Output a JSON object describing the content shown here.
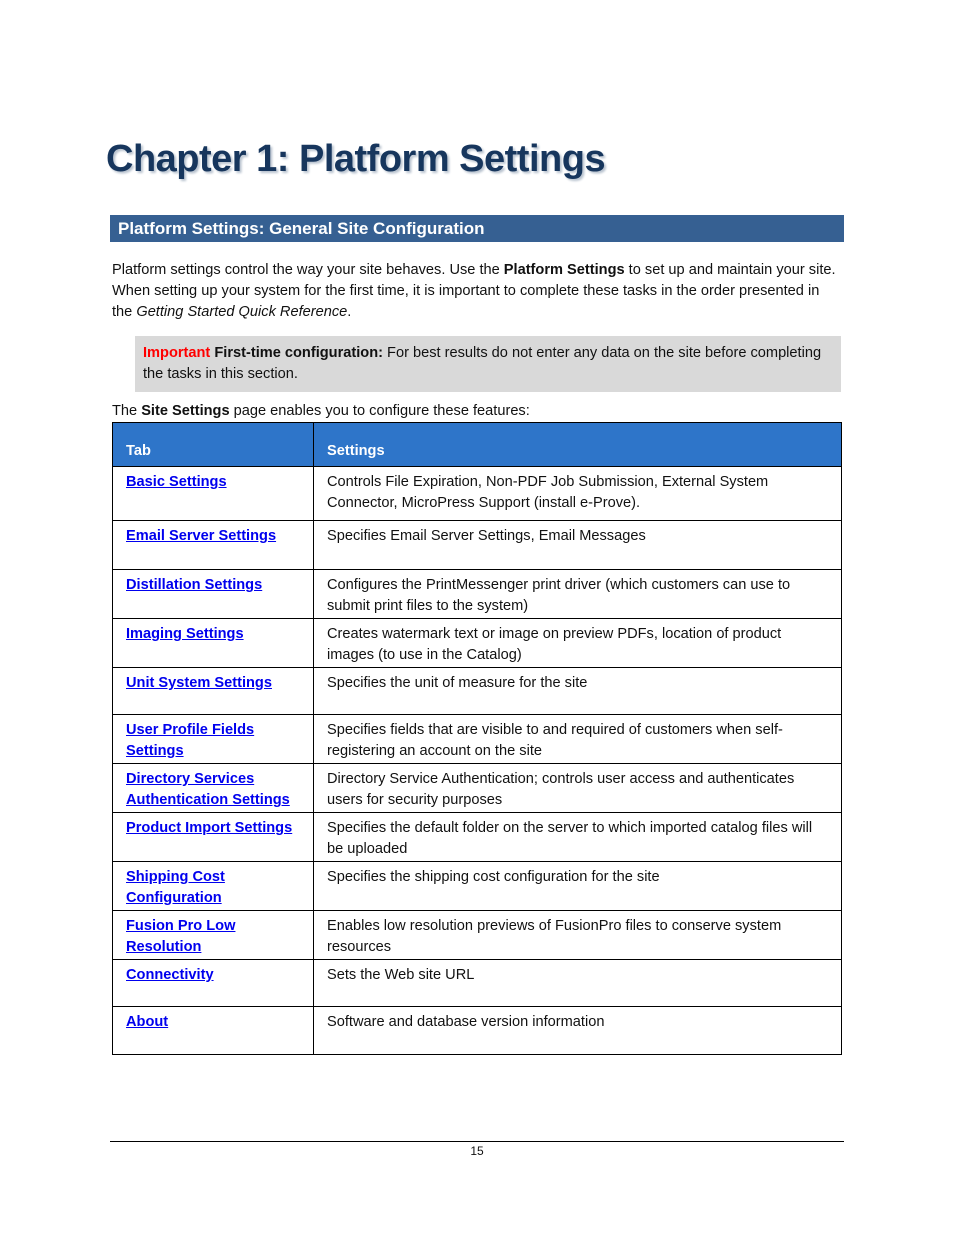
{
  "chapter_title": "Chapter 1: Platform Settings",
  "section_title": "Platform Settings: General Site Configuration",
  "intro": {
    "part1": "Platform settings control the way your site behaves. Use the ",
    "bold": "Platform Settings",
    "part2": " to set up and maintain your site. When setting up your system for the first time, it is important to complete these tasks in the order presented in the ",
    "italic": "Getting Started Quick Reference",
    "part3": "."
  },
  "note": {
    "important_label": "Important",
    "bold_label": "First-time configuration:",
    "text": " For best results do not enter any data on the site before completing the tasks in this section."
  },
  "lead": {
    "part1": "The ",
    "bold": "Site Settings",
    "part2": " page enables you to configure these features:"
  },
  "table": {
    "headers": [
      "Tab",
      "Settings"
    ],
    "rows": [
      {
        "tab": "Basic Settings",
        "settings": "Controls File Expiration, Non-PDF Job Submission, External System Connector, MicroPress Support (install e-Prove)."
      },
      {
        "tab": "Email Server Settings",
        "settings": "Specifies Email Server Settings, Email Messages"
      },
      {
        "tab": "Distillation Settings",
        "settings": "Configures the PrintMessenger print driver (which customers can use to submit print files to the system)"
      },
      {
        "tab": "Imaging Settings",
        "settings": "Creates watermark text or image on preview PDFs, location of product images (to use in the Catalog)"
      },
      {
        "tab": "Unit System Settings",
        "settings": "Specifies the unit of measure for the site"
      },
      {
        "tab": "User Profile Fields Settings",
        "settings": "Specifies fields that are visible to and required of customers when self-registering an account on the site"
      },
      {
        "tab": "Directory Services Authentication Settings",
        "settings": "Directory Service Authentication; controls user access and authenticates users for security purposes"
      },
      {
        "tab": "Product Import Settings",
        "settings": "Specifies the default folder on the server to which imported catalog files will be uploaded"
      },
      {
        "tab": "Shipping Cost Configuration",
        "settings": "Specifies the shipping cost configuration for the site"
      },
      {
        "tab": "Fusion Pro Low Resolution",
        "settings": "Enables low resolution previews of FusionPro files to conserve system resources"
      },
      {
        "tab": "Connectivity",
        "settings": "Sets the Web site URL"
      },
      {
        "tab": "About",
        "settings": "Software and database version information"
      }
    ]
  },
  "page_number": "15",
  "colors": {
    "chapter_title": "#17365d",
    "section_bar": "#366092",
    "table_header": "#2e75c9",
    "note_background": "#d9d9d9",
    "important": "#ff0000",
    "link": "#0000ee"
  }
}
